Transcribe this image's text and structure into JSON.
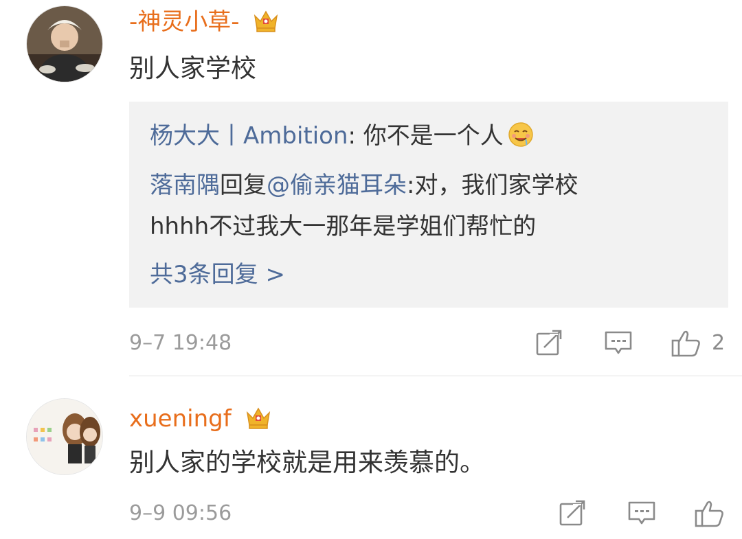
{
  "comments": [
    {
      "username": "-神灵小草-",
      "text": "别人家学校",
      "replies": {
        "line1_user": "杨大大丨Ambition",
        "line1_text": ": 你不是一个人",
        "line2_user": "落南隅",
        "line2_mid": "回复",
        "line2_mention": "@偷亲猫耳朵",
        "line2_text": ":对，我们家学校",
        "line3_text": "hhhh不过我大一那年是学姐们帮忙的",
        "more": "共3条回复 >"
      },
      "time": "9–7 19:48",
      "like_count": "2"
    },
    {
      "username": "xueningf",
      "text": "别人家的学校就是用来羡慕的。",
      "time": "9–9 09:56"
    }
  ],
  "colors": {
    "username": "#e86e1c",
    "link_blue": "#4e6b99",
    "text": "#333333",
    "meta": "#9b9b9b",
    "reply_bg": "#f2f2f2"
  },
  "icons": [
    "crown-badge-icon",
    "drool-emoji-icon",
    "share-icon",
    "comment-icon",
    "like-icon"
  ]
}
